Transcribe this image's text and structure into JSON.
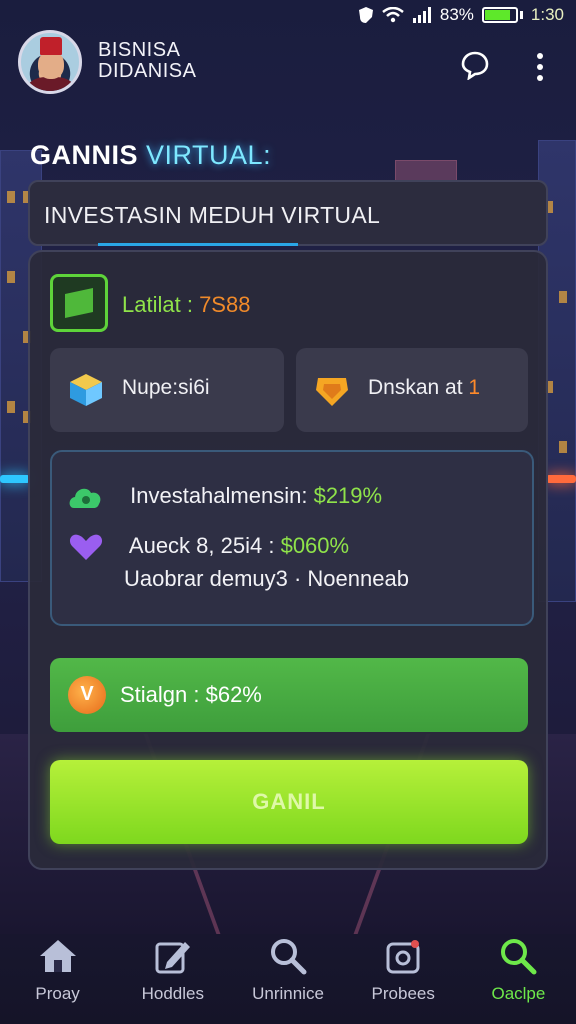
{
  "status_bar": {
    "battery_text": "83%",
    "time": "1:30",
    "battery_level": 0.83
  },
  "header": {
    "brand_line1": "BISNISA",
    "brand_line2": "DIDANISA"
  },
  "page_title": {
    "part1": "GANNIS",
    "part2": "VIRTUAL:"
  },
  "subtitle": "INVESTASIN MEDUH VIRTUAL",
  "level": {
    "label": "Latilat :",
    "value": "7S88"
  },
  "tiles": [
    {
      "label": "Nupe:si6i",
      "highlight": ""
    },
    {
      "label": "Dnskan at ",
      "highlight": "1"
    }
  ],
  "stats": {
    "row1_label": "Investahalmensin:",
    "row1_value": "$219%",
    "row2_label": "Aueck 8, 25i4 :",
    "row2_value": "$060%",
    "row3": "Uaobrar demuy3 ·  Noenneab"
  },
  "reward": {
    "coin": "V",
    "label": "Stialgn : $62%"
  },
  "cta_label": "GANIL",
  "nav": [
    {
      "label": "Proay",
      "icon": "home-icon"
    },
    {
      "label": "Hoddles",
      "icon": "edit-icon"
    },
    {
      "label": "Unrinnice",
      "icon": "search-icon"
    },
    {
      "label": "Probees",
      "icon": "settings-icon"
    },
    {
      "label": "Oaclpe",
      "icon": "search-icon"
    }
  ],
  "colors": {
    "accent_green": "#8fe34a",
    "accent_orange": "#f08a2a",
    "title_cyan": "#7ee8ff",
    "active_nav": "#6ee84a"
  }
}
